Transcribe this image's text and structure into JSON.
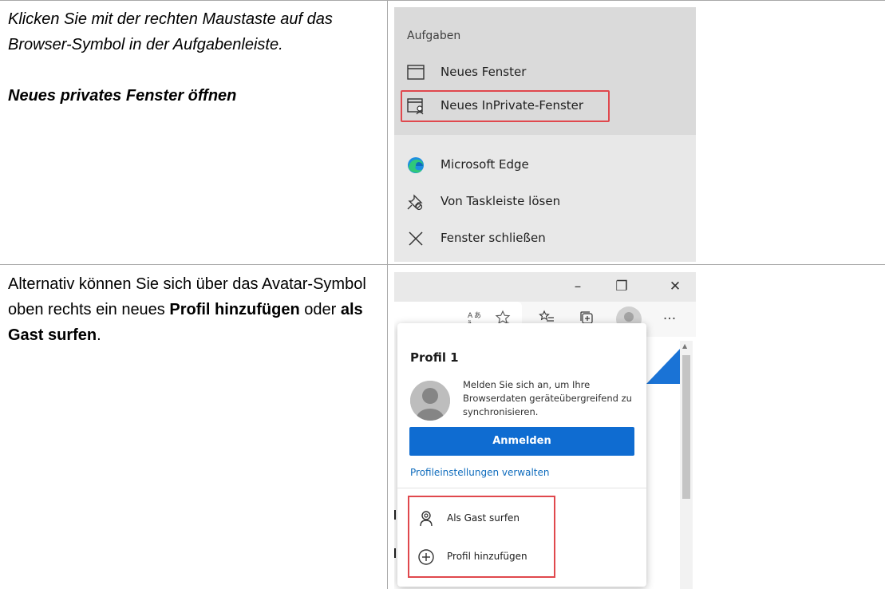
{
  "row1": {
    "instruction": "Klicken Sie mit der rechten Maustaste auf das Browser-Symbol in der Aufgabenleiste.",
    "heading": "Neues privates Fenster öffnen"
  },
  "row2": {
    "text_before": "Alternativ können Sie sich über das Avatar-Symbol oben rechts ein neues ",
    "emph1": "Profil hinzufügen",
    "text_mid": " oder ",
    "emph2": "als Gast surfen",
    "text_after": "."
  },
  "jumplist": {
    "header": "Aufgaben",
    "items": [
      {
        "label": "Neues Fenster",
        "icon": "window-icon"
      },
      {
        "label": "Neues InPrivate-Fenster",
        "icon": "inprivate-window-icon",
        "highlighted": true
      },
      {
        "label": "Microsoft Edge",
        "icon": "edge-logo-icon"
      },
      {
        "label": "Von Taskleiste lösen",
        "icon": "unpin-icon"
      },
      {
        "label": "Fenster schließen",
        "icon": "close-icon"
      }
    ],
    "highlight_color": "#e0484d"
  },
  "browser": {
    "window_controls": [
      "–",
      "❐",
      "✕"
    ],
    "toolbar_icons": [
      "read-aloud-icon",
      "favorite-star-icon",
      "favorites-list-icon",
      "collections-icon",
      "profile-avatar-icon",
      "more-icon"
    ],
    "more_glyph": "···",
    "profile_flyout": {
      "title": "Profil 1",
      "message": "Melden Sie sich an, um Ihre Browserdaten geräteübergreifend zu synchronisieren.",
      "signin_button": "Anmelden",
      "manage_link": "Profileinstellungen verwalten",
      "items": [
        {
          "label": "Als Gast surfen",
          "icon": "guest-icon"
        },
        {
          "label": "Profil hinzufügen",
          "icon": "add-profile-icon"
        }
      ]
    },
    "accent_color": "#0f6cd1"
  }
}
